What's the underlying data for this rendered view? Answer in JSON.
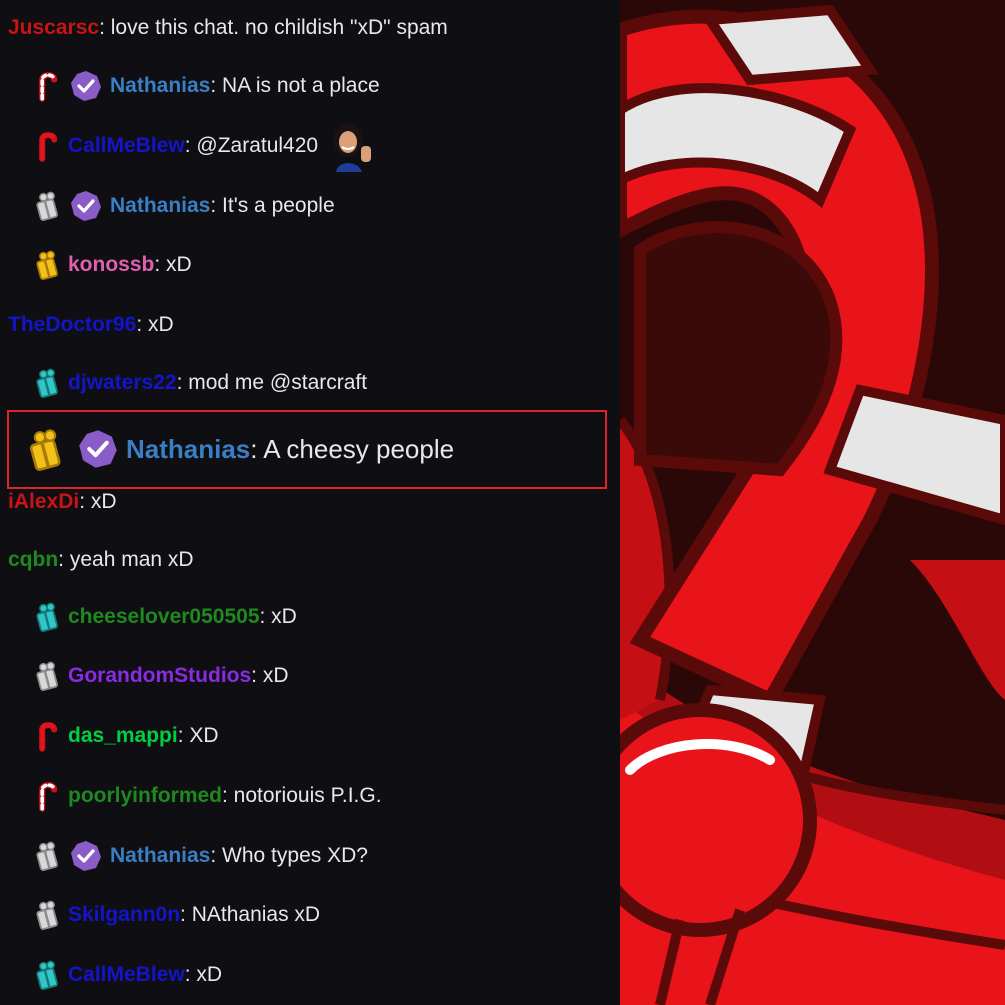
{
  "chat": {
    "messages": [
      {
        "id": "m1",
        "badge": "none",
        "verified": false,
        "username": "Juscarsc",
        "user_color": "#c81414",
        "text": ": love this chat. no childish \"xD\" spam"
      },
      {
        "id": "m2",
        "badge": "candy-cane",
        "verified": true,
        "username": "Nathanias",
        "user_color": "#3a7fc4",
        "text": ": NA is not a place"
      },
      {
        "id": "m3",
        "badge": "candy-cane-red",
        "verified": false,
        "username": "CallMeBlew",
        "user_color": "#1414c8",
        "text": ": @Zaratul420",
        "emote": "waving-woman-emote"
      },
      {
        "id": "m4",
        "badge": "gift-silver",
        "verified": true,
        "username": "Nathanias",
        "user_color": "#3a7fc4",
        "text": ": It's a people"
      },
      {
        "id": "m5",
        "badge": "gift-gold",
        "verified": false,
        "username": "konossb",
        "user_color": "#e060b0",
        "text": ": xD"
      },
      {
        "id": "m6",
        "badge": "none",
        "verified": false,
        "username": "TheDoctor96",
        "user_color": "#1414c8",
        "text": ": xD"
      },
      {
        "id": "m7",
        "badge": "gift-teal",
        "verified": false,
        "username": "djwaters22",
        "user_color": "#1414c8",
        "text": ": mod me @starcraft"
      },
      {
        "id": "m8",
        "badge": "gift-gold",
        "verified": true,
        "username": "Nathanias",
        "user_color": "#3a7fc4",
        "text": ": A cheesy people",
        "highlighted": true
      },
      {
        "id": "m9",
        "badge": "none",
        "verified": false,
        "username": "iAlexDi",
        "user_color": "#c81414",
        "text": ": xD"
      },
      {
        "id": "m10",
        "badge": "none",
        "verified": false,
        "username": "cqbn",
        "user_color": "#1e8a1e",
        "text": ": yeah man xD"
      },
      {
        "id": "m11",
        "badge": "gift-teal",
        "verified": false,
        "username": "cheeselover050505",
        "user_color": "#1e8a1e",
        "text": ": xD"
      },
      {
        "id": "m12",
        "badge": "gift-silver",
        "verified": false,
        "username": "GorandomStudios",
        "user_color": "#8a2be2",
        "text": ": xD"
      },
      {
        "id": "m13",
        "badge": "candy-cane-red",
        "verified": false,
        "username": "das_mappi",
        "user_color": "#00d040",
        "text": ": XD"
      },
      {
        "id": "m14",
        "badge": "candy-cane",
        "verified": false,
        "username": "poorlyinformed",
        "user_color": "#1e8a1e",
        "text": ": notoriouis P.I.G."
      },
      {
        "id": "m15",
        "badge": "gift-silver",
        "verified": true,
        "username": "Nathanias",
        "user_color": "#3a7fc4",
        "text": ": Who types XD?"
      },
      {
        "id": "m16",
        "badge": "gift-silver",
        "verified": false,
        "username": "Skilgann0n",
        "user_color": "#1414c8",
        "text": ": NAthanias xD"
      },
      {
        "id": "m17",
        "badge": "gift-teal",
        "verified": false,
        "username": "CallMeBlew",
        "user_color": "#1414c8",
        "text": ": xD"
      }
    ]
  },
  "colors": {
    "chat_background": "#0f0e13",
    "message_text": "#e8e8ec",
    "highlight_border": "#e0222a",
    "verified_badge": "#8a5cc7",
    "art_red": "#e8141a",
    "art_dark": "#2a0807"
  },
  "art": {
    "icon": "candy-cane-logo-art"
  }
}
